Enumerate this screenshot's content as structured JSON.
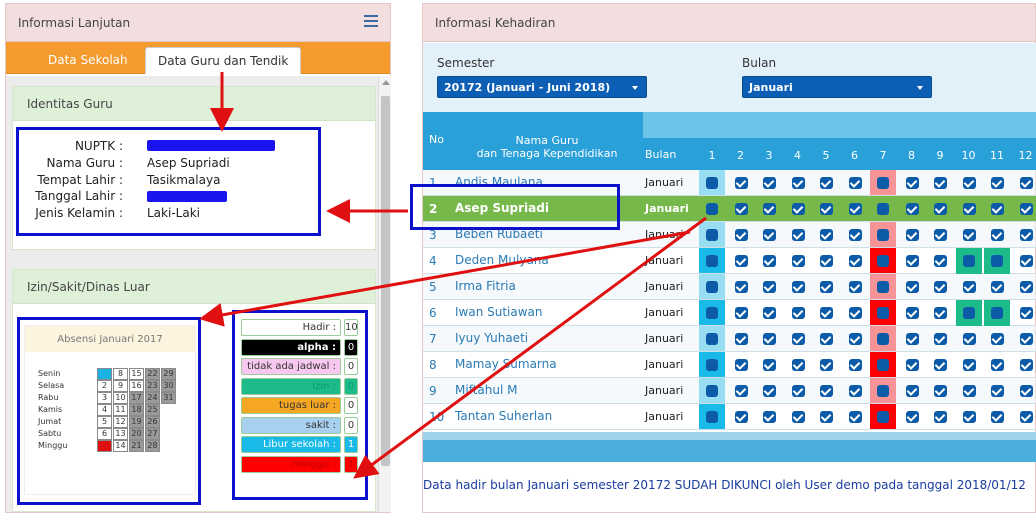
{
  "left_panel": {
    "title": "Informasi Lanjutan",
    "tabs": [
      "Data Sekolah",
      "Data Guru dan Tendik"
    ],
    "identity": {
      "title": "Identitas Guru",
      "fields": [
        {
          "label": "NUPTK :",
          "value": ""
        },
        {
          "label": "Nama Guru :",
          "value": "Asep Supriadi"
        },
        {
          "label": "Tempat Lahir :",
          "value": "Tasikmalaya"
        },
        {
          "label": "Tanggal Lahir :",
          "value": ""
        },
        {
          "label": "Jenis Kelamin :",
          "value": "Laki-Laki"
        }
      ]
    },
    "leave": {
      "title": "Izin/Sakit/Dinas Luar",
      "calendar_title": "Absensi Januari 2017",
      "days": [
        "Senin",
        "Selasa",
        "Rabu",
        "Kamis",
        "Jumat",
        "Sabtu",
        "Minggu"
      ],
      "weeks": [
        [
          "1",
          "2",
          "3",
          "4",
          "5",
          "6",
          "7"
        ],
        [
          "8",
          "9",
          "10",
          "11",
          "12",
          "13",
          "14"
        ],
        [
          "15",
          "16",
          "17",
          "18",
          "19",
          "20",
          "21"
        ],
        [
          "22",
          "23",
          "24",
          "25",
          "26",
          "27",
          "28"
        ],
        [
          "29",
          "30",
          "31",
          "",
          "",
          "",
          ""
        ]
      ],
      "legend": [
        {
          "label": "Hadir :",
          "count": "10",
          "bg": "#ffffff",
          "fg": "#333333"
        },
        {
          "label": "alpha :",
          "count": "0",
          "bg": "#000000",
          "fg": "#ffffff"
        },
        {
          "label": "tidak ada jadwal :",
          "count": "0",
          "bg": "#f8c8f0",
          "fg": "#333333"
        },
        {
          "label": "izin :",
          "count": "0",
          "bg": "#1dbb8a",
          "fg": "#0e9a6d"
        },
        {
          "label": "tugas luar :",
          "count": "0",
          "bg": "#f5a623",
          "fg": "#333333"
        },
        {
          "label": "sakit :",
          "count": "0",
          "bg": "#a8d0f0",
          "fg": "#333333"
        },
        {
          "label": "Libur sekolah :",
          "count": "1",
          "bg": "#19b9e8",
          "fg": "#ffffff"
        },
        {
          "label": "minggu :",
          "count": "1",
          "bg": "#ff0000",
          "fg": "#c00000"
        }
      ]
    }
  },
  "right_panel": {
    "title": "Informasi Kehadiran",
    "semester_label": "Semester",
    "semester_value": "20172 (Januari - Juni 2018)",
    "month_label": "Bulan",
    "month_value": "Januari",
    "headers": {
      "no": "No",
      "name_line1": "Nama Guru",
      "name_line2": "dan Tenaga Kependidikan",
      "month": "Bulan"
    },
    "day_headers": [
      "1",
      "2",
      "3",
      "4",
      "5",
      "6",
      "7",
      "8",
      "9",
      "10",
      "11",
      "12"
    ],
    "rows": [
      {
        "no": "1",
        "name": "Andis Maulana",
        "month": "Januari"
      },
      {
        "no": "2",
        "name": "Asep Supriadi",
        "month": "Januari"
      },
      {
        "no": "3",
        "name": "Beben Rubaeti",
        "month": "Januari"
      },
      {
        "no": "4",
        "name": "Deden Mulyana",
        "month": "Januari"
      },
      {
        "no": "5",
        "name": "Irma Fitria",
        "month": "Januari"
      },
      {
        "no": "6",
        "name": "Iwan Sutiawan",
        "month": "Januari"
      },
      {
        "no": "7",
        "name": "Iyuy Yuhaeti",
        "month": "Januari"
      },
      {
        "no": "8",
        "name": "Mamay Sumarna",
        "month": "Januari"
      },
      {
        "no": "9",
        "name": "Miftahul M",
        "month": "Januari"
      },
      {
        "no": "10",
        "name": "Tantan Suherlan",
        "month": "Januari"
      }
    ],
    "note": "Data hadir bulan Januari semester 20172 SUDAH DIKUNCI oleh User demo pada tanggal 2018/01/12"
  },
  "colors": {
    "accent_blue": "#0c11cc",
    "arrow_red": "#e01010",
    "tab_orange": "#f59a2c",
    "highlight_green": "#77b84b"
  }
}
